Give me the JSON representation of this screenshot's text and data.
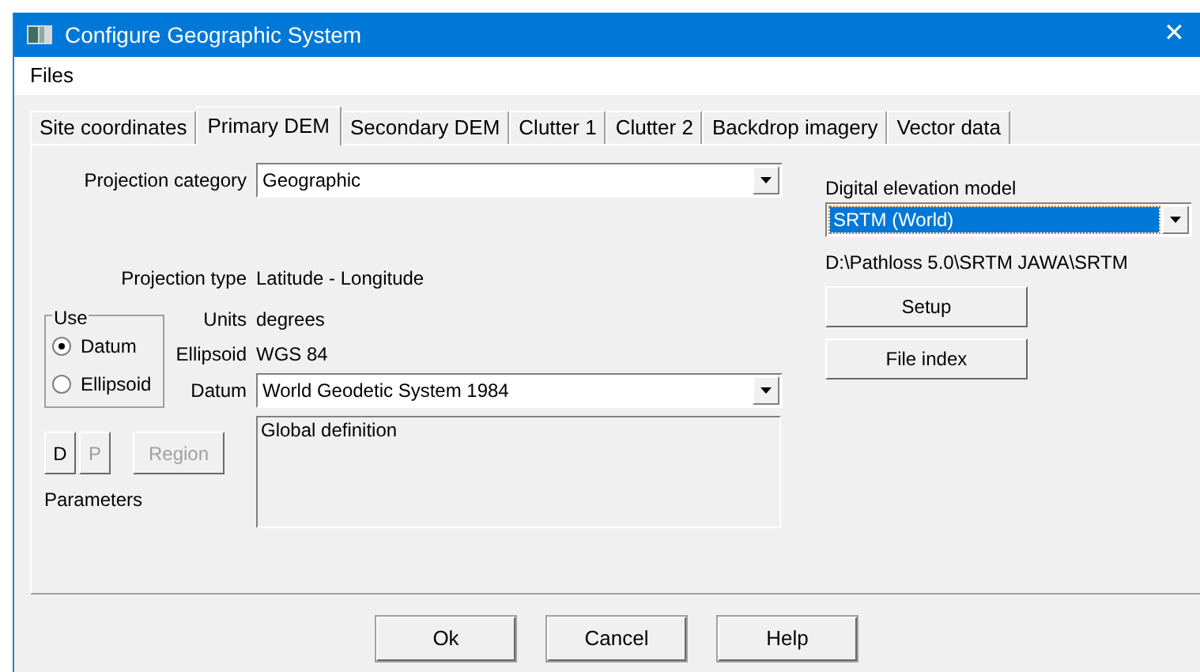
{
  "window": {
    "title": "Configure Geographic System",
    "close": "✕"
  },
  "menu": [
    "Files"
  ],
  "tabs": [
    {
      "label": "Site coordinates",
      "selected": false
    },
    {
      "label": "Primary DEM",
      "selected": true
    },
    {
      "label": "Secondary DEM",
      "selected": false
    },
    {
      "label": "Clutter 1",
      "selected": false
    },
    {
      "label": "Clutter 2",
      "selected": false
    },
    {
      "label": "Backdrop imagery",
      "selected": false
    },
    {
      "label": "Vector data",
      "selected": false
    }
  ],
  "projection_category": {
    "label": "Projection category",
    "value": "Geographic"
  },
  "projection_type": {
    "label": "Projection type",
    "value": "Latitude - Longitude"
  },
  "use": {
    "label": "Use",
    "options": [
      {
        "label": "Datum",
        "selected": true
      },
      {
        "label": "Ellipsoid",
        "selected": false
      }
    ]
  },
  "units": {
    "label": "Units",
    "value": "degrees"
  },
  "ellipsoid": {
    "label": "Ellipsoid",
    "value": "WGS 84"
  },
  "datum": {
    "label": "Datum",
    "value": "World Geodetic System 1984"
  },
  "definition": "Global definition",
  "parameter_buttons": [
    {
      "label": "D",
      "disabled": false
    },
    {
      "label": "P",
      "disabled": true
    },
    {
      "label": "Region",
      "disabled": true
    }
  ],
  "parameters_label": "Parameters",
  "dem": {
    "label": "Digital elevation model",
    "value": "SRTM (World)",
    "focused": true,
    "path": "D:\\Pathloss 5.0\\SRTM JAWA\\SRTM"
  },
  "dem_buttons": [
    "Setup",
    "File index"
  ],
  "buttons": [
    "Ok",
    "Cancel",
    "Help"
  ]
}
